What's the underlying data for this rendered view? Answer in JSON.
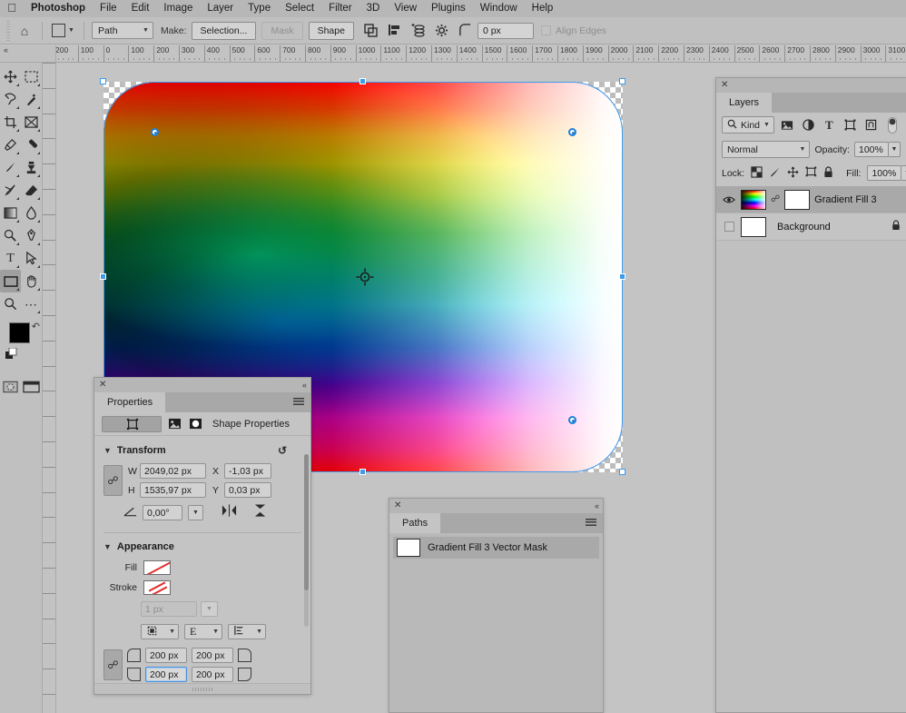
{
  "menubar": {
    "apple": "apple-logo",
    "items": [
      {
        "label": "Photoshop",
        "bold": true
      },
      {
        "label": "File",
        "bold": false
      },
      {
        "label": "Edit",
        "bold": false
      },
      {
        "label": "Image",
        "bold": false
      },
      {
        "label": "Layer",
        "bold": false
      },
      {
        "label": "Type",
        "bold": false
      },
      {
        "label": "Select",
        "bold": false
      },
      {
        "label": "Filter",
        "bold": false
      },
      {
        "label": "3D",
        "bold": false
      },
      {
        "label": "View",
        "bold": false
      },
      {
        "label": "Plugins",
        "bold": false
      },
      {
        "label": "Window",
        "bold": false
      },
      {
        "label": "Help",
        "bold": false
      }
    ]
  },
  "options_bar": {
    "home_icon": "home-icon",
    "tool_preset_icon": "rectangle-tool-icon",
    "mode_select": "Path",
    "make_label": "Make:",
    "selection_button": "Selection...",
    "mask_button": "Mask",
    "shape_button": "Shape",
    "path_operations_icon": "path-operations-icon",
    "path_alignment_icon": "path-alignment-icon",
    "path_arrangement_icon": "path-arrangement-icon",
    "geometry_options_icon": "gear-icon",
    "corner_radius_icon": "corner-radius-icon",
    "corner_radius_value": "0 px",
    "align_edges_label": "Align Edges"
  },
  "ruler": {
    "unit": "px",
    "labels": [
      "200",
      "100",
      "0",
      "100",
      "200",
      "300",
      "400",
      "500",
      "600",
      "700",
      "800",
      "900",
      "1000",
      "1100",
      "1200",
      "1300",
      "1400",
      "1500",
      "1600",
      "1700",
      "1800",
      "1900",
      "2000",
      "2100",
      "2200",
      "2300",
      "2400",
      "2500",
      "2600",
      "2700",
      "2800",
      "2900",
      "3000",
      "3100"
    ]
  },
  "toolbar": {
    "tools": [
      {
        "name": "move-tool",
        "glyph": "move"
      },
      {
        "name": "rectangular-marquee-tool",
        "glyph": "marquee"
      },
      {
        "name": "lasso-tool",
        "glyph": "lasso"
      },
      {
        "name": "quick-selection-tool",
        "glyph": "wand"
      },
      {
        "name": "crop-tool",
        "glyph": "crop"
      },
      {
        "name": "frame-tool",
        "glyph": "frame"
      },
      {
        "name": "eyedropper-tool",
        "glyph": "eyedropper"
      },
      {
        "name": "spot-healing-brush-tool",
        "glyph": "heal"
      },
      {
        "name": "brush-tool",
        "glyph": "brush"
      },
      {
        "name": "clone-stamp-tool",
        "glyph": "stamp"
      },
      {
        "name": "history-brush-tool",
        "glyph": "historybrush"
      },
      {
        "name": "eraser-tool",
        "glyph": "eraser"
      },
      {
        "name": "gradient-tool",
        "glyph": "gradient"
      },
      {
        "name": "blur-tool",
        "glyph": "blur"
      },
      {
        "name": "dodge-tool",
        "glyph": "dodge"
      },
      {
        "name": "pen-tool",
        "glyph": "pen"
      },
      {
        "name": "horizontal-type-tool",
        "glyph": "type"
      },
      {
        "name": "path-selection-tool",
        "glyph": "arrow"
      },
      {
        "name": "rectangle-tool",
        "glyph": "rectangle",
        "active": true
      },
      {
        "name": "hand-tool",
        "glyph": "hand"
      },
      {
        "name": "zoom-tool",
        "glyph": "zoom"
      },
      {
        "name": "edit-toolbar-tool",
        "glyph": "ellipsis"
      }
    ],
    "foreground_color": "#000000",
    "background_color": "#ffffff",
    "swap_colors_icon": "swap-colors-icon",
    "default_colors_icon": "default-colors-icon",
    "quick_mask_icon": "quick-mask-icon",
    "screen_mode_icon": "screen-mode-icon"
  },
  "canvas": {
    "layer_name": "Gradient Fill 3",
    "corner_radius_px": 200,
    "shape_type": "rounded-rectangle",
    "transform_handles": 8,
    "reference_point": "center"
  },
  "properties_panel": {
    "title": "Properties",
    "close_icon": "close-icon",
    "collapse_icon": "collapse-icon",
    "menu_icon": "panel-menu-icon",
    "header_icons": [
      "shape-properties-icon",
      "image-properties-icon",
      "mask-properties-icon"
    ],
    "header_label": "Shape Properties",
    "transform": {
      "section_title": "Transform",
      "reset_icon": "reset-icon",
      "link_icon": "link-aspect-ratio-icon",
      "w_label": "W",
      "w_value": "2049,02 px",
      "x_label": "X",
      "x_value": "-1,03 px",
      "h_label": "H",
      "h_value": "1535,97 px",
      "y_label": "Y",
      "y_value": "0,03 px",
      "angle_icon": "angle-icon",
      "angle_value": "0,00°",
      "flip_horizontal_icon": "flip-horizontal-icon",
      "flip_vertical_icon": "flip-vertical-icon"
    },
    "appearance": {
      "section_title": "Appearance",
      "fill_label": "Fill",
      "fill_value": "none",
      "stroke_label": "Stroke",
      "stroke_value": "none",
      "stroke_width": "1 px",
      "stroke_align_icon": "stroke-align-icon",
      "stroke_cap_icon": "stroke-cap-icon",
      "stroke_corner_icon": "stroke-corner-icon",
      "link_corners_icon": "link-corner-radii-icon",
      "corners": [
        {
          "name": "top-left-radius",
          "value": "200 px",
          "focused": false
        },
        {
          "name": "top-right-radius",
          "value": "200 px",
          "focused": false
        },
        {
          "name": "bottom-left-radius",
          "value": "200 px",
          "focused": true
        },
        {
          "name": "bottom-right-radius",
          "value": "200 px",
          "focused": false
        }
      ]
    }
  },
  "layers_panel": {
    "title": "Layers",
    "close_icon": "close-icon",
    "menu_icon": "panel-menu-icon",
    "filter_label": "Kind",
    "filter_search_icon": "search-icon",
    "filter_icons": [
      "pixel-filter-icon",
      "adjustment-filter-icon",
      "type-filter-icon",
      "shape-filter-icon",
      "smart-object-filter-icon"
    ],
    "filter_toggle_icon": "filter-toggle-icon",
    "blend_mode": "Normal",
    "opacity_label": "Opacity:",
    "opacity_value": "100%",
    "lock_label": "Lock:",
    "lock_icons": [
      "lock-transparent-pixels-icon",
      "lock-image-pixels-icon",
      "lock-position-icon",
      "lock-artboard-icon",
      "lock-all-icon"
    ],
    "fill_label": "Fill:",
    "fill_value": "100%",
    "layers": [
      {
        "name": "Gradient Fill 3",
        "visible": true,
        "selected": true,
        "has_mask": true,
        "locked": false,
        "thumb": "gradient"
      },
      {
        "name": "Background",
        "visible": false,
        "selected": false,
        "has_mask": false,
        "locked": true,
        "thumb": "white"
      }
    ]
  },
  "paths_panel": {
    "title": "Paths",
    "close_icon": "close-icon",
    "collapse_icon": "collapse-icon",
    "menu_icon": "panel-menu-icon",
    "items": [
      {
        "name": "Gradient Fill 3 Vector Mask",
        "selected": true
      }
    ]
  },
  "colors": {
    "accent": "#3d9be9",
    "panel_bg": "#c0c0c0",
    "app_bg": "#c4c4c4",
    "menubar_bg": "#b7b7b7",
    "selected_row": "#a9a9a9"
  }
}
